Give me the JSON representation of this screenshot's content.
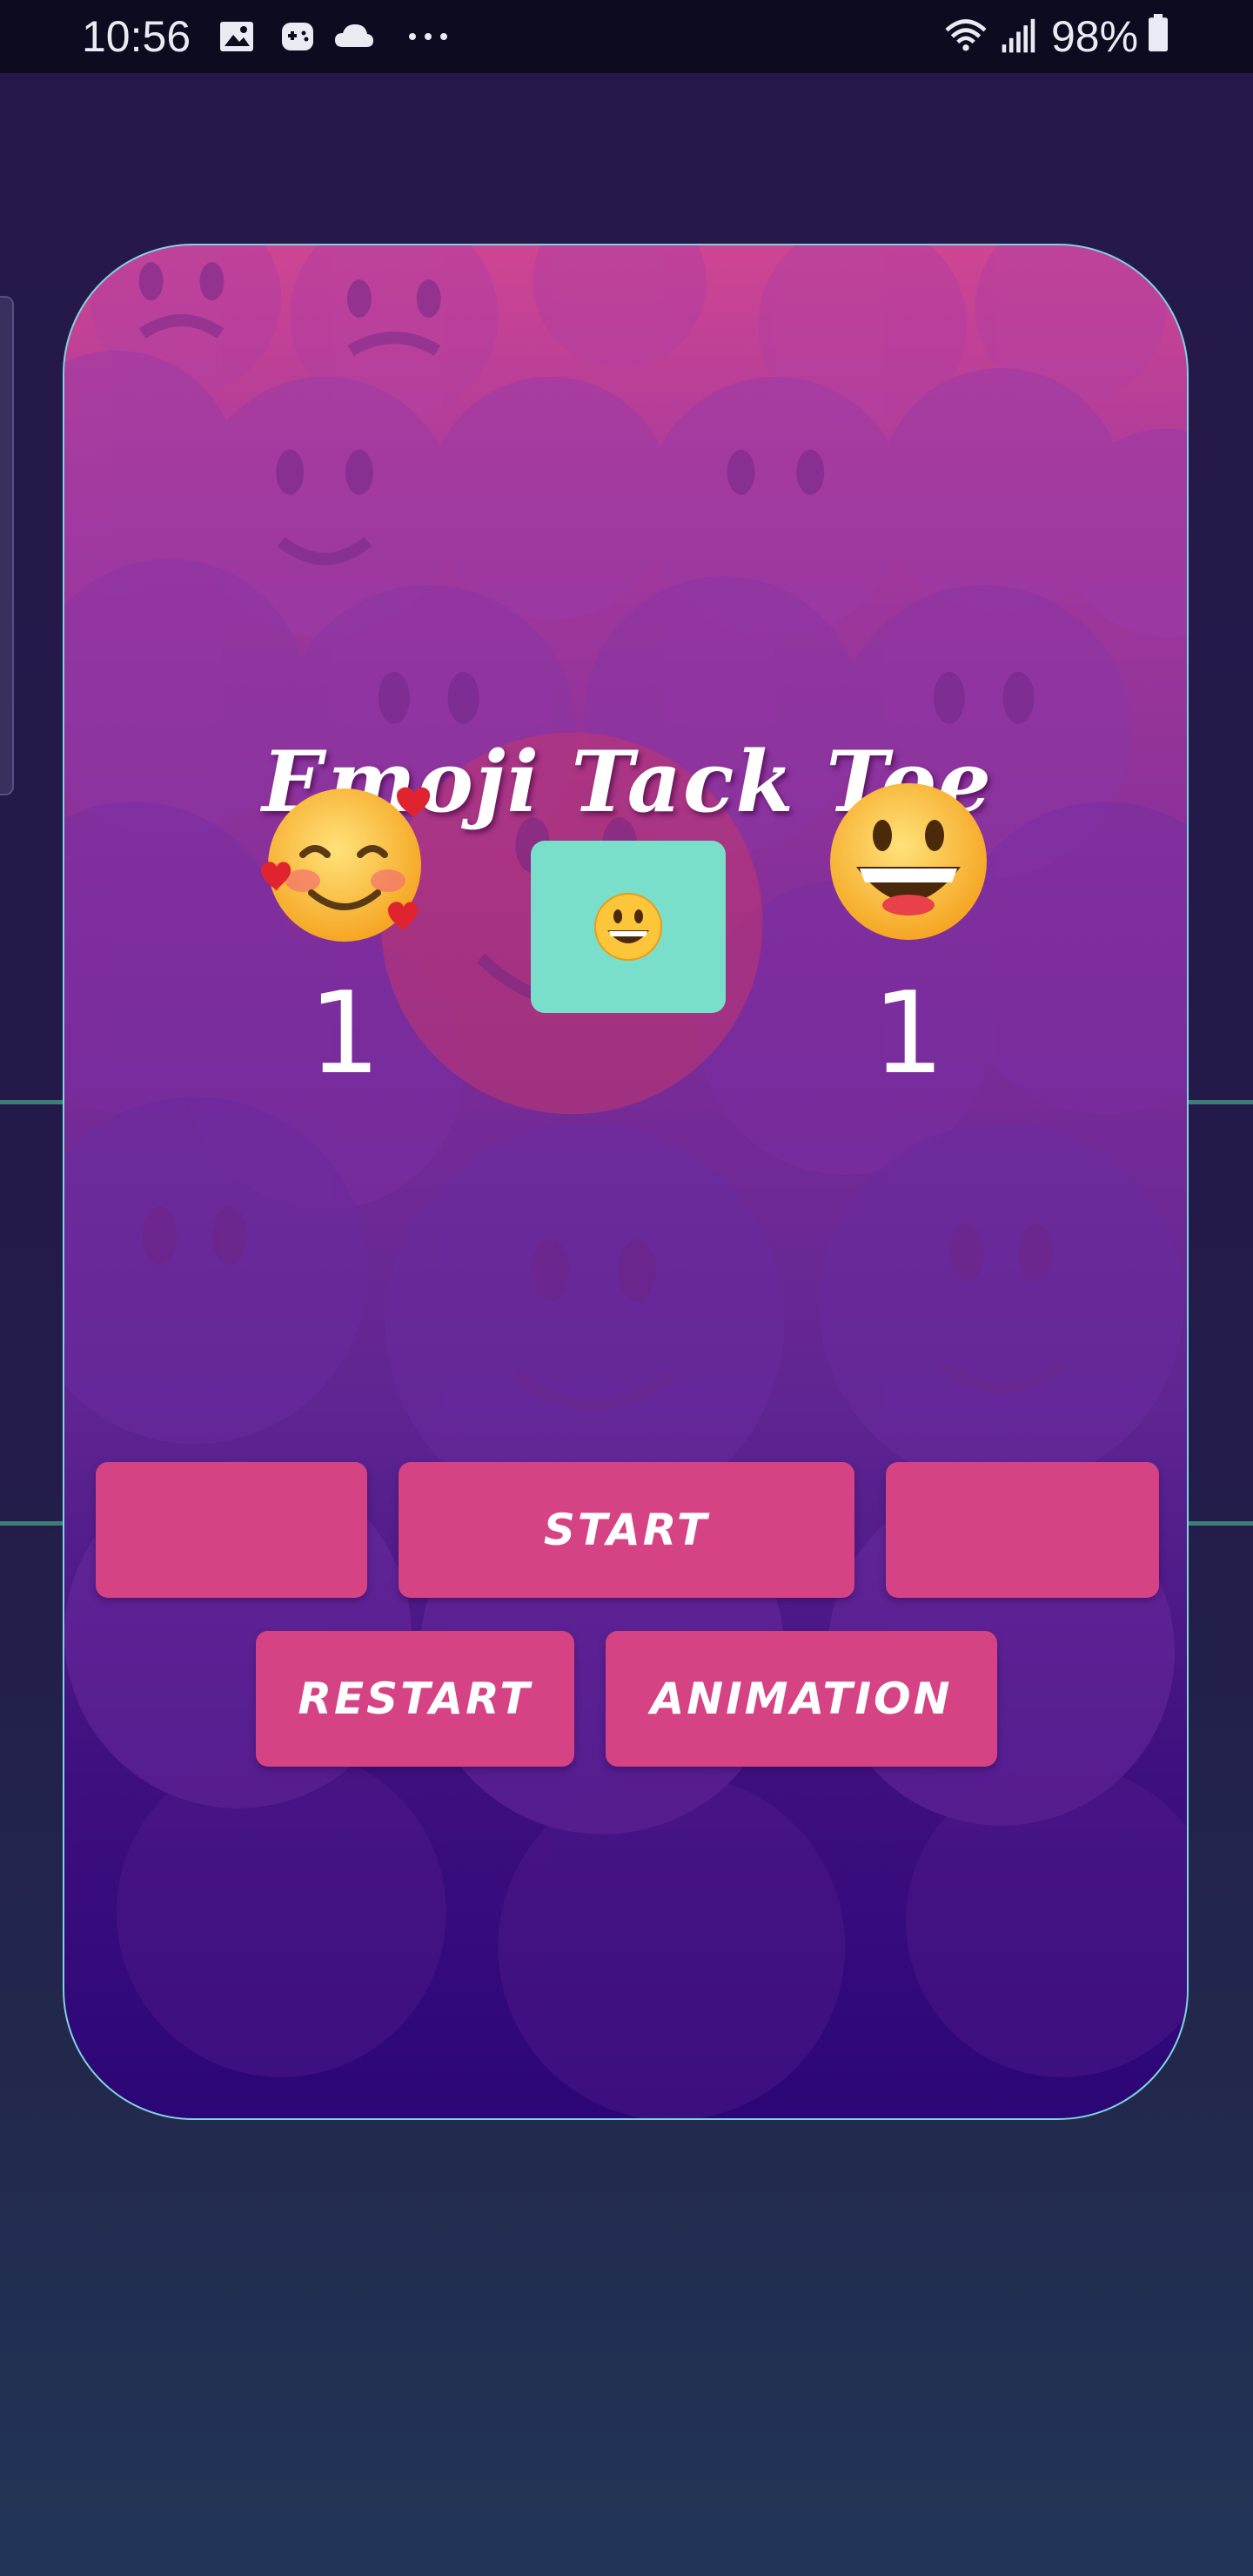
{
  "status_bar": {
    "time": "10:56",
    "battery_percent": "98%",
    "left_icons": [
      "image-icon",
      "game-controller-icon",
      "cloud-icon",
      "more-dots-icon"
    ],
    "right_icons": [
      "wifi-icon",
      "signal-icon",
      "battery-icon"
    ]
  },
  "app": {
    "title": "Emoji Tack Toe",
    "player1": {
      "emoji": "smiling-face-with-hearts",
      "score": "1"
    },
    "player2": {
      "emoji": "grinning-face",
      "score": "1"
    },
    "current_turn_emoji": "grinning-face"
  },
  "buttons": {
    "left_blank": "",
    "start": "START",
    "right_blank": "",
    "restart": "RESTART",
    "animation": "ANIMATION"
  },
  "colors": {
    "button": "#d64385",
    "turn_box": "#79dfcb",
    "card_top": "#cf4593",
    "card_bottom": "#2c0676"
  }
}
